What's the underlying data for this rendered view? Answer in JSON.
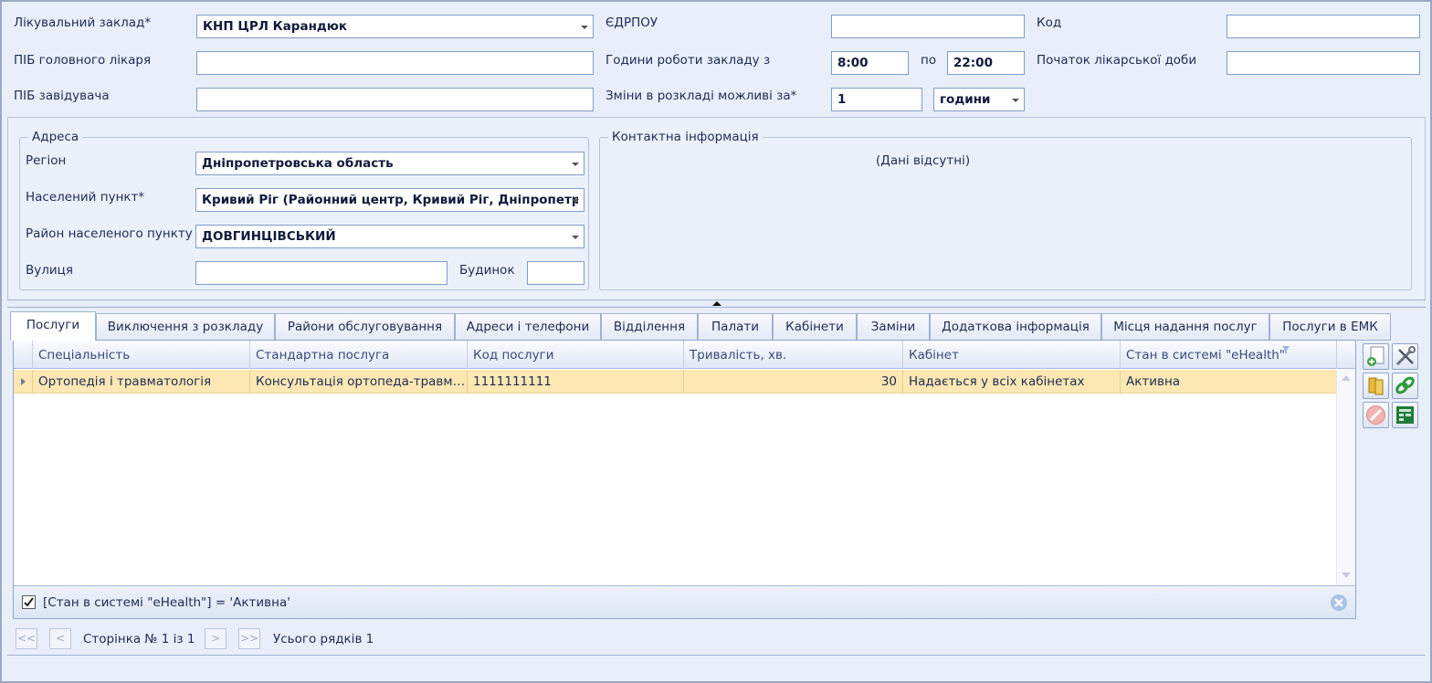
{
  "form": {
    "facility_label": "Лікувальний заклад*",
    "facility_value": "КНП ЦРЛ Карандюк",
    "chief_label": "ПІБ головного лікаря",
    "chief_value": "",
    "head_label": "ПІБ завідувача",
    "head_value": "",
    "edrpou_label": "ЄДРПОУ",
    "edrpou_value": "",
    "hours_label": "Години роботи закладу з",
    "hours_from": "8:00",
    "hours_to_label": "по",
    "hours_to": "22:00",
    "changes_label": "Зміни в розкладі можливі за*",
    "changes_value": "1",
    "changes_unit": "години",
    "code_label": "Код",
    "code_value": "",
    "daystart_label": "Початок лікарської доби",
    "daystart_value": ""
  },
  "address": {
    "legend": "Адреса",
    "region_label": "Регіон",
    "region_value": "Дніпропетровська область",
    "locality_label": "Населений пункт*",
    "locality_value": "Кривий Ріг (Районний центр, Кривий Ріг, Дніпропетровська область)",
    "district_label": "Район населеного пункту",
    "district_value": "ДОВГИНЦІВСЬКИЙ",
    "street_label": "Вулиця",
    "street_value": "",
    "building_label": "Будинок",
    "building_value": ""
  },
  "contacts": {
    "legend": "Контактна інформація",
    "empty_text": "(Дані відсутні)"
  },
  "tabs": [
    {
      "label": "Послуги",
      "active": true
    },
    {
      "label": "Виключення з розкладу"
    },
    {
      "label": "Райони обслуговування"
    },
    {
      "label": "Адреси і телефони"
    },
    {
      "label": "Відділення"
    },
    {
      "label": "Палати"
    },
    {
      "label": "Кабінети"
    },
    {
      "label": "Заміни"
    },
    {
      "label": "Додаткова інформація"
    },
    {
      "label": "Місця надання послуг"
    },
    {
      "label": "Послуги в ЕМК"
    }
  ],
  "grid": {
    "columns": [
      "Спеціальність",
      "Стандартна послуга",
      "Код послуги",
      "Тривалість, хв.",
      "Кабінет",
      "Стан в системі \"eHealth\""
    ],
    "rows": [
      [
        "Ортопедія і травматологія",
        "Консультація ортопеда-травматолога",
        "1111111111",
        "30",
        "Надається у всіх кабінетах",
        "Активна"
      ]
    ],
    "filter_text": "[Стан в системі \"eHealth\"] = 'Активна'",
    "filter_checked": true
  },
  "toolbar_icons": [
    "add-icon",
    "edit-tools-icon",
    "copy-icon",
    "link-icon",
    "delete-icon",
    "export-excel-icon"
  ],
  "pager": {
    "first": "<<",
    "prev": "<",
    "page_text": "Сторінка № 1 із 1",
    "next": ">",
    "last": ">>",
    "total_text": "Усього рядків 1"
  }
}
